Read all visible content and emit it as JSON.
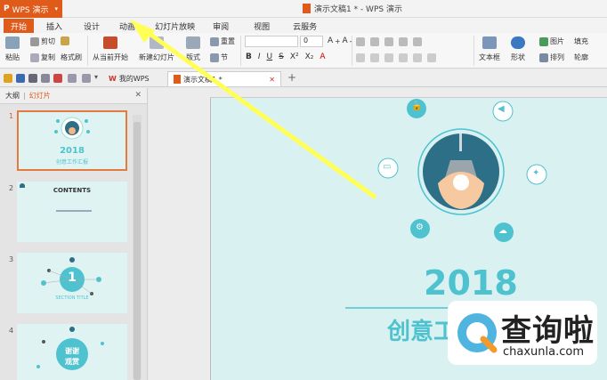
{
  "app": {
    "name": "WPS 演示",
    "logo": "P"
  },
  "window": {
    "title": "演示文稿1 * - WPS 演示"
  },
  "ribbon_tabs": [
    {
      "label": "开始",
      "active": true
    },
    {
      "label": "插入"
    },
    {
      "label": "设计"
    },
    {
      "label": "动画"
    },
    {
      "label": "幻灯片放映"
    },
    {
      "label": "审阅"
    },
    {
      "label": "视图"
    },
    {
      "label": "云服务"
    }
  ],
  "ribbon": {
    "paste": "粘贴",
    "cut": "剪切",
    "copy": "复制",
    "format_painter": "格式刷",
    "from_current": "从当前开始",
    "new_slide": "新建幻灯片",
    "layout": "版式",
    "reset": "重置",
    "section": "节",
    "font_size": "0",
    "textbox": "文本框",
    "shape": "形状",
    "picture": "图片",
    "fill": "填充",
    "arrange": "排列",
    "outline": "轮廓"
  },
  "doc_tabs": [
    {
      "label": "我的WPS"
    },
    {
      "label": "演示文稿1 *",
      "active": true
    }
  ],
  "left_pane": {
    "tab_outline": "大纲",
    "tab_slides": "幻灯片",
    "thumbnails": [
      {
        "num": "1",
        "title": "2018",
        "sub": "创意工作汇报"
      },
      {
        "num": "2",
        "title": "CONTENTS",
        "sub": ""
      },
      {
        "num": "3",
        "title": "1",
        "sub": "SECTION TITLE"
      },
      {
        "num": "4",
        "title": "谢谢",
        "sub": "观赏"
      }
    ]
  },
  "slide": {
    "year": "2018",
    "subtitle_partial": "创意工"
  },
  "watermark": {
    "cn": "查询啦",
    "en": "chaxunla.com"
  },
  "colors": {
    "accent": "#e05a1a",
    "teal": "#4fc2d0",
    "dark_teal": "#2c6f86",
    "slide_bg": "#daf1f1",
    "arrow": "#ffff55"
  },
  "icons": [
    "save-icon",
    "undo-icon",
    "redo-icon",
    "print-icon",
    "lock-icon",
    "speaker-icon",
    "chat-icon",
    "bird-icon",
    "tool-icon",
    "cloud-icon",
    "lamp-icon",
    "search-icon"
  ]
}
